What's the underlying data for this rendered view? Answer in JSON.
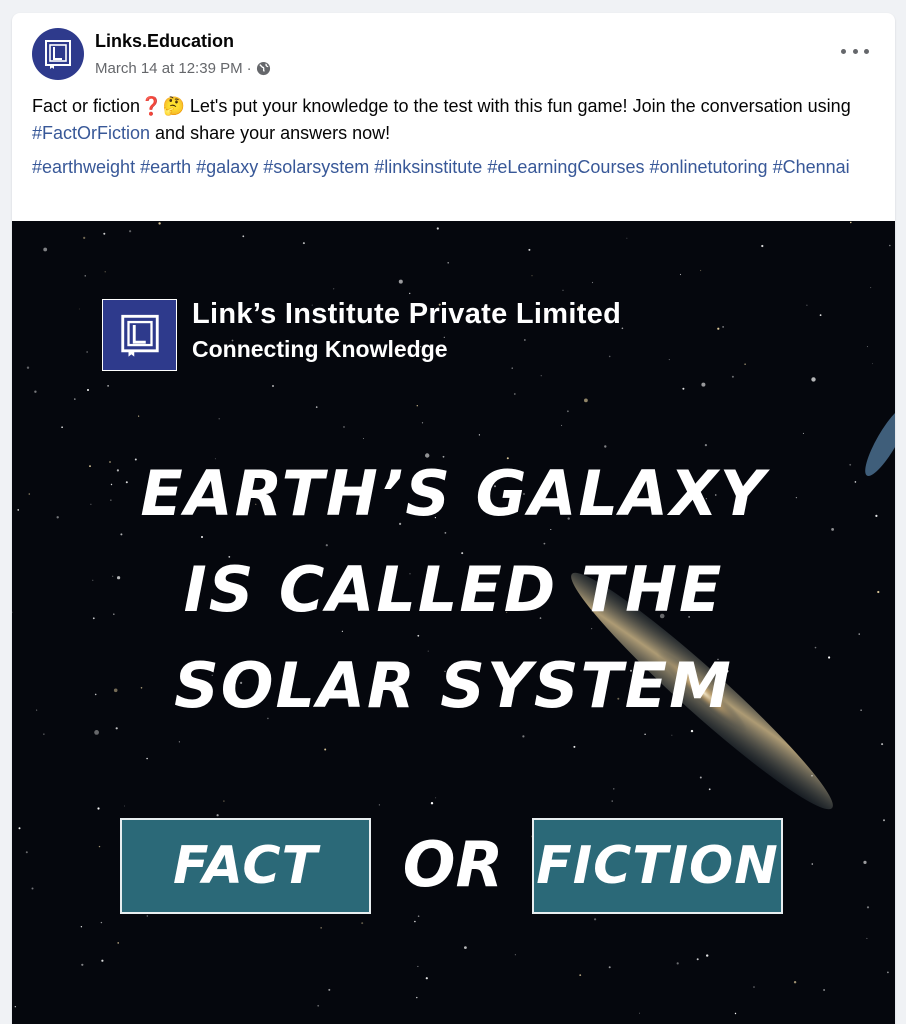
{
  "post": {
    "page_name": "Links.Education",
    "timestamp": "March 14 at 12:39 PM",
    "separator": "·",
    "audience_icon": "globe-icon",
    "more_icon": "more-dots-icon",
    "text_part1": "Fact or fiction",
    "text_emoji": "❓🤔",
    "text_part2": " Let's put your knowledge to the test with this fun game! Join the conversation using ",
    "text_link": "#FactOrFiction",
    "text_part3": " and share your answers now!",
    "hashtags": [
      "#earthweight",
      "#earth",
      "#galaxy",
      "#solarsystem",
      "#linksinstitute",
      "#eLearningCourses",
      "#onlinetutoring",
      "#Chennai"
    ]
  },
  "image": {
    "brand_name": "Link’s Institute Private Limited",
    "brand_tagline": "Connecting Knowledge",
    "headline_lines": [
      "Earth’s Galaxy",
      "is Called the",
      "Solar System"
    ],
    "option_fact": "Fact",
    "or_label": "OR",
    "option_fiction": "Fiction"
  },
  "colors": {
    "brand_blue": "#2e3a8c",
    "button_teal": "#2b6978",
    "link_blue": "#385898",
    "space_bg": "#05070d"
  }
}
